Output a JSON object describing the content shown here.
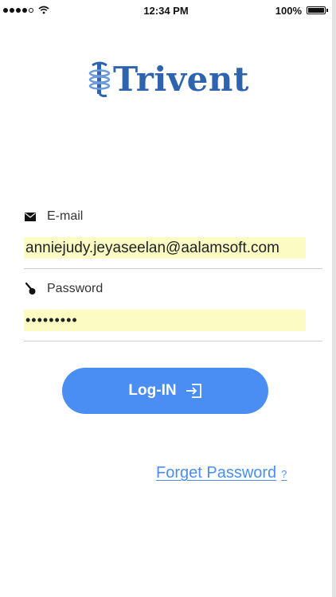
{
  "status_bar": {
    "time": "12:34 PM",
    "battery_percent": "100%",
    "signal_bars_filled": 4,
    "signal_bars_total": 5
  },
  "brand": {
    "logo_text": "Trivent",
    "color": "#2e63ae"
  },
  "form": {
    "email": {
      "label": "E-mail",
      "icon": "envelope-icon",
      "value": "anniejudy.jeyaseelan@aalamsoft.com",
      "autofill_color": "#fbfcc3"
    },
    "password": {
      "label": "Password",
      "icon": "key-icon",
      "value": "•••••••••"
    }
  },
  "login_button": {
    "label": "Log-IN",
    "icon": "login-arrow-icon",
    "color": "#4a8ef4"
  },
  "forgot_password": {
    "label": "Forget Password",
    "suffix": "?",
    "color": "#4a8ef4"
  }
}
